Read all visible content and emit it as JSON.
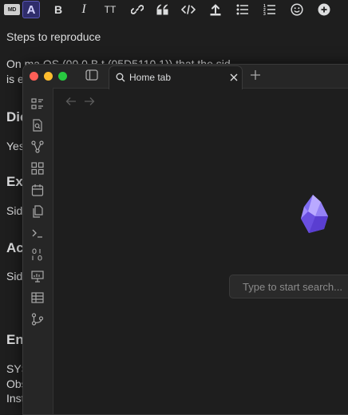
{
  "editor": {
    "toolbar": {
      "markdown_label": "MD",
      "font_label": "A",
      "bold_label": "B",
      "italic_label": "I",
      "heading_label": "TT"
    },
    "doc": {
      "line1": "Steps to reproduce",
      "line2a": "On ma OS (00.0 B t (05D5110 1))",
      "line2a_tail": "that the sid",
      "line2b": "is e",
      "line3a": "Dic",
      "line4": "Yes",
      "line5": "Exp",
      "line6": "Side",
      "line7": "Act",
      "line8": "Side",
      "line9": "Env",
      "line10": "SYS",
      "line11": "Obs",
      "line12": "Inst"
    }
  },
  "window": {
    "tab_title": "Home tab",
    "search_placeholder": "Type to start search...",
    "ribbon_icons": [
      "tasks-icon",
      "quick-switch-icon",
      "graph-icon",
      "canvas-icon",
      "calendar-icon",
      "pages-icon",
      "terminal-icon",
      "binary-icon",
      "slides-icon",
      "table-icon",
      "git-icon"
    ]
  },
  "colors": {
    "accent": "#7f6df2",
    "background": "#1e1e1e",
    "toolbar_active": "#2f2d6b"
  }
}
